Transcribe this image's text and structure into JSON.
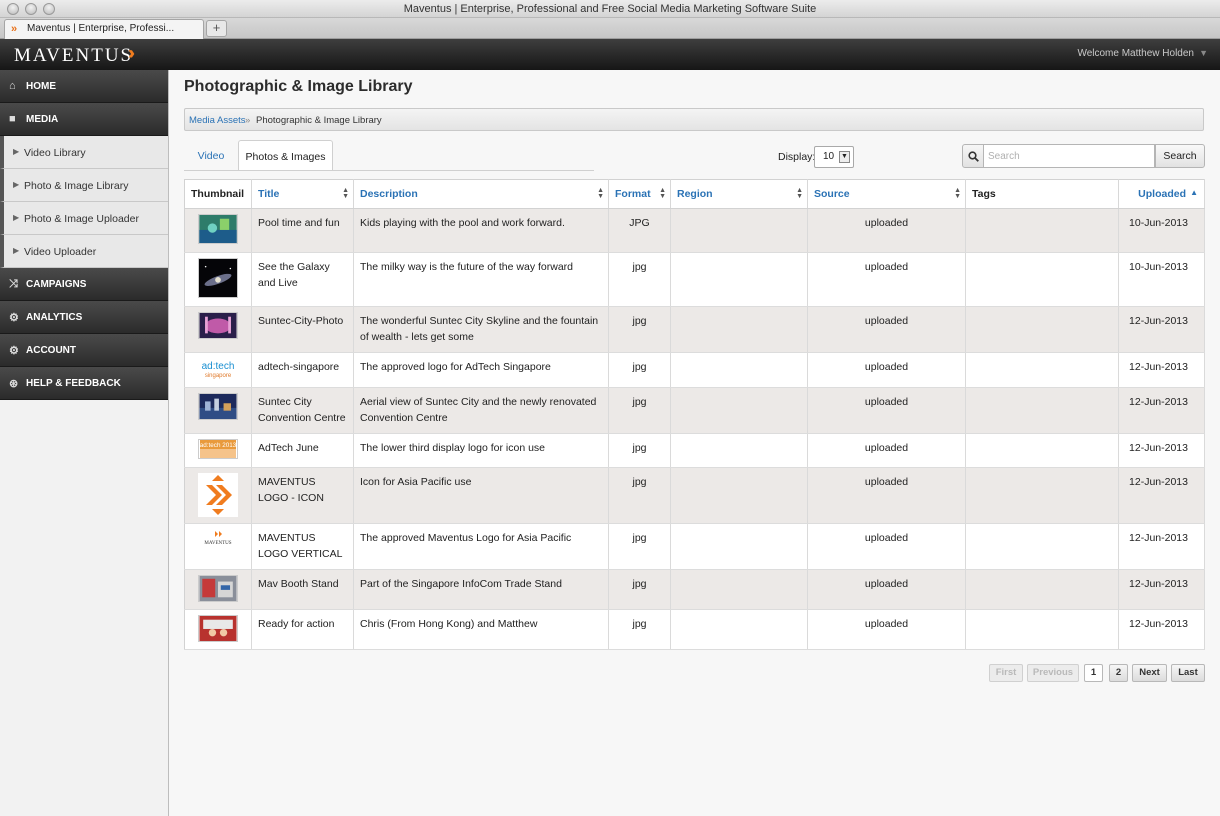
{
  "browser": {
    "window_title": "Maventus | Enterprise, Professional and Free Social Media Marketing Software Suite",
    "tab_title": "Maventus | Enterprise, Professi...",
    "new_tab": "+"
  },
  "header": {
    "logo_text": "MAVENTUS",
    "welcome": "Welcome Matthew Holden"
  },
  "sidebar": {
    "items": [
      {
        "label": "HOME",
        "icon": "home-icon"
      },
      {
        "label": "MEDIA",
        "icon": "camera-icon"
      },
      {
        "label": "Video Library"
      },
      {
        "label": "Photo & Image Library"
      },
      {
        "label": "Photo & Image Uploader"
      },
      {
        "label": "Video Uploader"
      },
      {
        "label": "CAMPAIGNS",
        "icon": "shuffle-icon"
      },
      {
        "label": "ANALYTICS",
        "icon": "gear-icon"
      },
      {
        "label": "ACCOUNT",
        "icon": "gear-icon"
      },
      {
        "label": "HELP & FEEDBACK",
        "icon": "lifebuoy-icon"
      }
    ]
  },
  "page": {
    "title": "Photographic & Image Library",
    "breadcrumb": {
      "link": "Media Assets",
      "separator": "»",
      "current": "Photographic & Image Library"
    },
    "tabs": [
      "Video",
      "Photos & Images"
    ],
    "display_label": "Display:",
    "display_value": "10",
    "search_placeholder": "Search",
    "search_button": "Search"
  },
  "table": {
    "columns": [
      "Thumbnail",
      "Title",
      "Description",
      "Format",
      "Region",
      "Source",
      "Tags",
      "Uploaded"
    ],
    "rows": [
      {
        "thumb": "pool",
        "title": "Pool time and fun",
        "description": "Kids playing with the pool and work forward.",
        "format": "JPG",
        "region": "",
        "source": "uploaded",
        "tags": "",
        "uploaded": "10-Jun-2013"
      },
      {
        "thumb": "galaxy",
        "title": "See the Galaxy and Live",
        "description": "The milky way is the future of the way forward",
        "format": "jpg",
        "region": "",
        "source": "uploaded",
        "tags": "",
        "uploaded": "10-Jun-2013"
      },
      {
        "thumb": "city",
        "title": "Suntec-City-Photo",
        "description": "The wonderful Suntec City Skyline and the fountain of wealth - lets get some",
        "format": "jpg",
        "region": "",
        "source": "uploaded",
        "tags": "",
        "uploaded": "12-Jun-2013"
      },
      {
        "thumb": "adtech",
        "title": "adtech-singapore",
        "description": "The approved logo for AdTech Singapore",
        "format": "jpg",
        "region": "",
        "source": "uploaded",
        "tags": "",
        "uploaded": "12-Jun-2013"
      },
      {
        "thumb": "aerial",
        "title": "Suntec City Convention Centre",
        "description": "Aerial view of Suntec City and the newly renovated Convention Centre",
        "format": "jpg",
        "region": "",
        "source": "uploaded",
        "tags": "",
        "uploaded": "12-Jun-2013"
      },
      {
        "thumb": "adtech2013",
        "title": "AdTech June",
        "description": "The lower third display logo for icon use",
        "format": "jpg",
        "region": "",
        "source": "uploaded",
        "tags": "",
        "uploaded": "12-Jun-2013"
      },
      {
        "thumb": "mavicon",
        "title": "MAVENTUS LOGO - ICON",
        "description": "Icon for Asia Pacific use",
        "format": "jpg",
        "region": "",
        "source": "uploaded",
        "tags": "",
        "uploaded": "12-Jun-2013"
      },
      {
        "thumb": "mavlogo",
        "title": "MAVENTUS LOGO VERTICAL",
        "description": "The approved Maventus Logo for Asia Pacific",
        "format": "jpg",
        "region": "",
        "source": "uploaded",
        "tags": "",
        "uploaded": "12-Jun-2013"
      },
      {
        "thumb": "booth",
        "title": "Mav Booth Stand",
        "description": "Part of the Singapore InfoCom Trade Stand",
        "format": "jpg",
        "region": "",
        "source": "uploaded",
        "tags": "",
        "uploaded": "12-Jun-2013"
      },
      {
        "thumb": "action",
        "title": "Ready for action",
        "description": "Chris (From Hong Kong) and Matthew",
        "format": "jpg",
        "region": "",
        "source": "uploaded",
        "tags": "",
        "uploaded": "12-Jun-2013"
      }
    ]
  },
  "pagination": {
    "first": "First",
    "previous": "Previous",
    "pages": [
      "1",
      "2"
    ],
    "next": "Next",
    "last": "Last"
  },
  "colors": {
    "link": "#2a72b5",
    "accent": "#f07c1f",
    "header_bg": "#1e1e1e"
  }
}
